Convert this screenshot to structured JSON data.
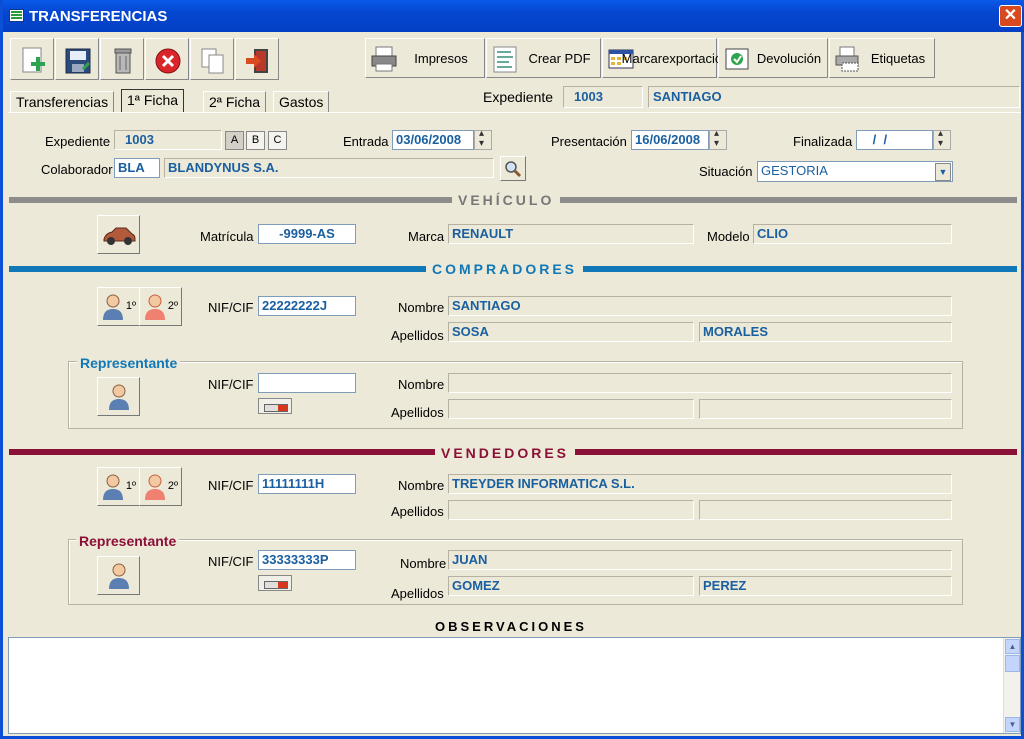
{
  "window": {
    "title": "TRANSFERENCIAS"
  },
  "toolbar": {
    "impresos": "Impresos",
    "crear_pdf": "Crear PDF",
    "marcar_line1": "Marcar",
    "marcar_line2": "exportación",
    "devolucion": "Devolución",
    "etiquetas": "Etiquetas"
  },
  "tabs": {
    "t1": "Transferencias",
    "t2": "1ª Ficha",
    "t3": "2ª Ficha",
    "t4": "Gastos"
  },
  "header": {
    "expediente_label": "Expediente",
    "expediente_num": "1003",
    "expediente_name": "SANTIAGO"
  },
  "general": {
    "expediente_label": "Expediente",
    "expediente": "1003",
    "a": "A",
    "b": "B",
    "c": "C",
    "entrada_label": "Entrada",
    "entrada": "03/06/2008",
    "presentacion_label": "Presentación",
    "presentacion": "16/06/2008",
    "finalizada_label": "Finalizada",
    "finalizada": " /  / ",
    "colaborador_label": "Colaborador",
    "colaborador_code": "BLA",
    "colaborador_name": "BLANDYNUS S.A.",
    "situacion_label": "Situación",
    "situacion": "GESTORIA"
  },
  "vehiculo": {
    "title": "VEHÍCULO",
    "matricula_label": "Matrícula",
    "matricula": "-9999-AS",
    "marca_label": "Marca",
    "marca": "RENAULT",
    "modelo_label": "Modelo",
    "modelo": "CLIO"
  },
  "compradores": {
    "title": "COMPRADORES",
    "btn1": "1º",
    "btn2": "2º",
    "nif_label": "NIF/CIF",
    "nif": "22222222J",
    "nombre_label": "Nombre",
    "nombre": "SANTIAGO",
    "apellidos_label": "Apellidos",
    "apellido1": "SOSA",
    "apellido2": "MORALES",
    "rep": {
      "title": "Representante",
      "nif_label": "NIF/CIF",
      "nif": "",
      "nombre_label": "Nombre",
      "nombre": "",
      "apellidos_label": "Apellidos",
      "apellido1": "",
      "apellido2": ""
    }
  },
  "vendedores": {
    "title": "VENDEDORES",
    "btn1": "1º",
    "btn2": "2º",
    "nif_label": "NIF/CIF",
    "nif": "11111111H",
    "nombre_label": "Nombre",
    "nombre": "TREYDER INFORMATICA S.L.",
    "apellidos_label": "Apellidos",
    "apellido1": "",
    "apellido2": "",
    "rep": {
      "title": "Representante",
      "nif_label": "NIF/CIF",
      "nif": "33333333P",
      "nombre_label": "Nombre",
      "nombre": "JUAN",
      "apellidos_label": "Apellidos",
      "apellido1": "GOMEZ",
      "apellido2": "PEREZ"
    }
  },
  "observaciones": {
    "title": "OBSERVACIONES",
    "text": ""
  },
  "colors": {
    "blue_section": "#1178b8",
    "red_section": "#8b1038",
    "gray_section": "#8c8c8c",
    "field_text": "#1a5fa0"
  }
}
